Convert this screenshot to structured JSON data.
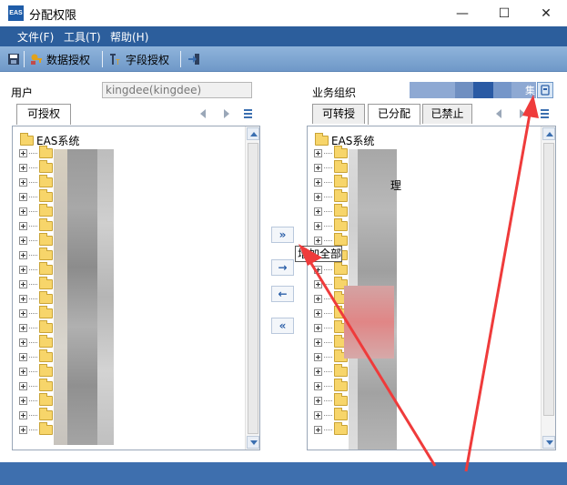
{
  "window": {
    "app_icon_text": "EAS",
    "title": "分配权限",
    "minimize_glyph": "—",
    "maximize_glyph": "☐",
    "close_glyph": "✕"
  },
  "menu": {
    "items": [
      {
        "label": "文件(F)"
      },
      {
        "label": "工具(T)"
      },
      {
        "label": "帮助(H)"
      }
    ]
  },
  "toolbar": {
    "save_icon": "save-icon",
    "data_auth_label": "数据授权",
    "field_auth_label": "字段授权"
  },
  "form": {
    "user_label": "用户",
    "user_value": "kingdee(kingdee)",
    "org_label": "业务组织",
    "org_value_tail": "集"
  },
  "left_panel": {
    "tab_label": "可授权",
    "root_label": "EAS系统",
    "row_count": 20
  },
  "right_panel": {
    "tabs": [
      {
        "label": "可转授"
      },
      {
        "label": "已分配"
      },
      {
        "label": "已禁止"
      }
    ],
    "active_tab_index": 1,
    "root_label": "EAS系统",
    "row_count": 20,
    "partial_text": "理"
  },
  "transfer_buttons": {
    "add_all_glyph": "»",
    "add_glyph": "→",
    "remove_glyph": "←",
    "remove_all_glyph": "«",
    "tooltip": "增加全部"
  },
  "colors": {
    "menubar": "#2c5e9c",
    "toolbar": "#7ea6d3",
    "annotation_arrow": "#ef3b3b",
    "statusbar": "#3e6fae"
  }
}
